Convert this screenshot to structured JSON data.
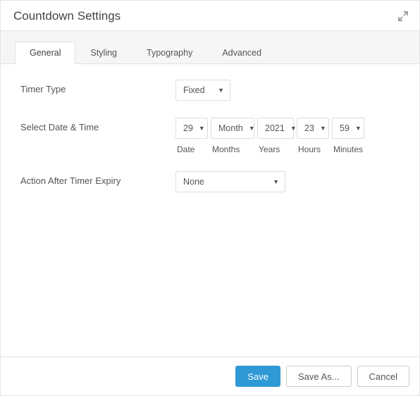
{
  "header": {
    "title": "Countdown Settings"
  },
  "tabs": {
    "general": "General",
    "styling": "Styling",
    "typography": "Typography",
    "advanced": "Advanced"
  },
  "form": {
    "timer_type": {
      "label": "Timer Type",
      "value": "Fixed"
    },
    "datetime": {
      "label": "Select Date & Time",
      "date": {
        "value": "29",
        "caption": "Date"
      },
      "month": {
        "value": "Month",
        "caption": "Months"
      },
      "year": {
        "value": "2021",
        "caption": "Years"
      },
      "hour": {
        "value": "23",
        "caption": "Hours"
      },
      "minute": {
        "value": "59",
        "caption": "Minutes"
      }
    },
    "action_expiry": {
      "label": "Action After Timer Expiry",
      "value": "None"
    }
  },
  "footer": {
    "save": "Save",
    "save_as": "Save As...",
    "cancel": "Cancel"
  }
}
